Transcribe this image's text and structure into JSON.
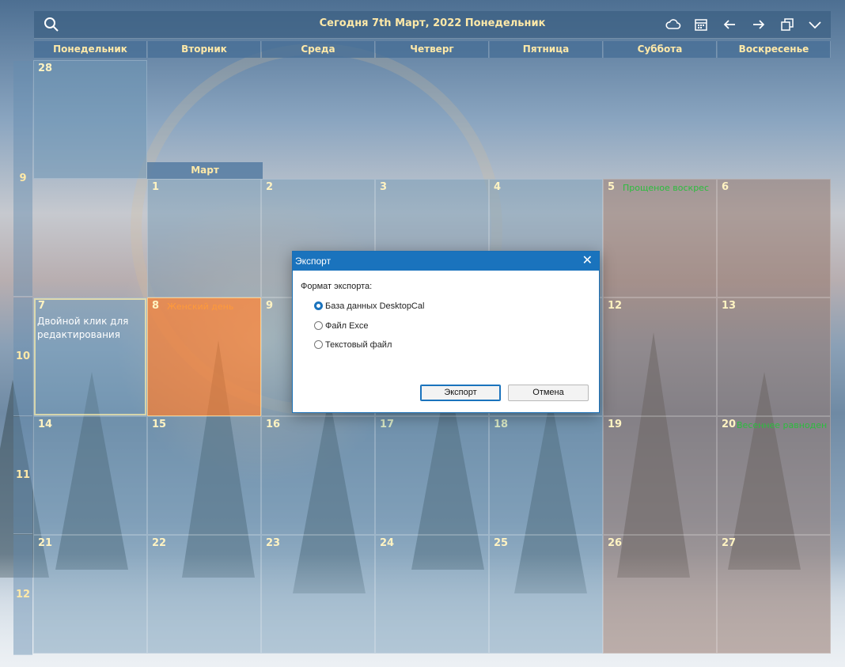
{
  "header": {
    "title": "Сегодня 7th Март, 2022 Понедельник",
    "icons": [
      "search-icon",
      "cloud-icon",
      "calendar-icon",
      "arrow-left-icon",
      "arrow-right-icon",
      "restore-icon",
      "chevron-down-icon"
    ]
  },
  "days": [
    "Понедельник",
    "Вторник",
    "Среда",
    "Четверг",
    "Пятница",
    "Суббота",
    "Воскресенье"
  ],
  "weeks": [
    "9",
    "10",
    "11",
    "12"
  ],
  "month_label": "Март",
  "cells": {
    "d28": "28",
    "d1": "1",
    "d2": "2",
    "d3": "3",
    "d4": "4",
    "d5": "5",
    "d6": "6",
    "d7": "7",
    "d8": "8",
    "d9": "9",
    "d12": "12",
    "d13": "13",
    "d14": "14",
    "d15": "15",
    "d16": "16",
    "d17": "17",
    "d18": "18",
    "d19": "19",
    "d20": "20",
    "d21": "21",
    "d22": "22",
    "d23": "23",
    "d24": "24",
    "d25": "25",
    "d26": "26",
    "d27": "27"
  },
  "events": {
    "d5": "Прощеное воскрес",
    "d8": "Женский день",
    "d20": "Весеннее равноден"
  },
  "note_d7": "Двойной клик для редактирования",
  "dialog": {
    "title": "Экспорт",
    "format_label": "Формат экспорта:",
    "options": [
      "База данных DesktopCal",
      "Файл Exce",
      "Текстовый файл"
    ],
    "selected": "База данных DesktopCal",
    "export_button": "Экспорт",
    "cancel_button": "Отмена"
  },
  "colors": {
    "header_text": "#ffe9a8",
    "holiday_green": "#2bbd3e",
    "today_orange": "#f0823c",
    "dialog_accent": "#1a73bd"
  }
}
